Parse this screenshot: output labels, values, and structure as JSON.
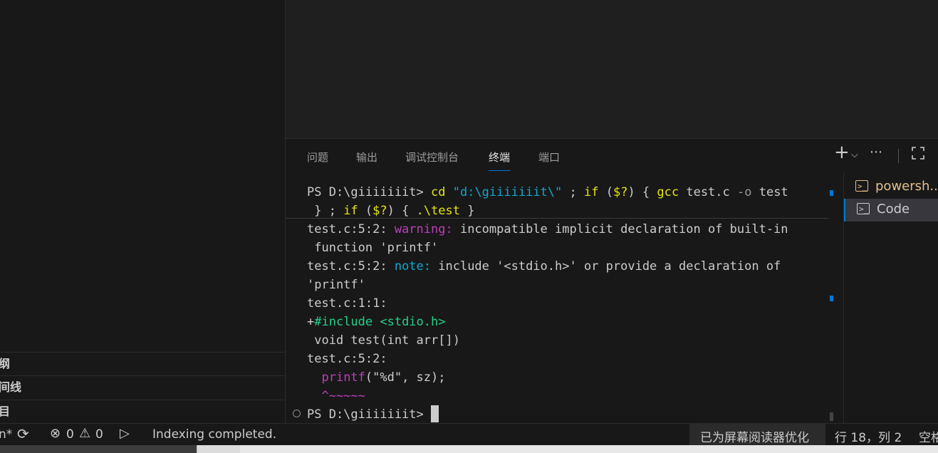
{
  "sidebar": {
    "sections": [
      "纲",
      "间线",
      "目"
    ]
  },
  "panel": {
    "tabs": [
      "问题",
      "输出",
      "调试控制台",
      "终端",
      "端口"
    ],
    "active_tab": "终端",
    "actions": {
      "add_icon": "plus-icon",
      "dropdown_icon": "chevron-down-icon",
      "more_icon": "ellipsis-icon",
      "maximize_icon": "maximize-icon"
    }
  },
  "terminal": {
    "prompt": "PS D:\\giiiiiiit> ",
    "cmd_cd": "cd",
    "cmd_path": "\"d:\\giiiiiiit\\\"",
    "cmd_semi1": " ; ",
    "cmd_if1": "if",
    "cmd_cond1_open": " (",
    "cmd_var1": "$?",
    "cmd_cond1_close": ") { ",
    "cmd_gcc": "gcc",
    "cmd_file": " test.c ",
    "cmd_flag": "-o",
    "cmd_out": " test",
    "line2_start": " } ; ",
    "cmd_if2": "if",
    "cmd_cond2_open": " (",
    "cmd_var2": "$?",
    "cmd_cond2_close": ") { ",
    "cmd_run": ".\\test",
    "cmd_end": " }",
    "w_loc": "test.c:5:2: ",
    "w_kw": "warning:",
    "w_msg": " incompatible implicit declaration of built-in",
    "w_msg2": " function 'printf'",
    "n_loc": "test.c:5:2: ",
    "n_kw": "note:",
    "n_msg": " include '<stdio.h>' or provide a declaration of",
    "n_msg2": "'printf'",
    "loc3": "test.c:1:1:",
    "plus": "+",
    "include": "#include <stdio.h>",
    "code1": " void test(int arr[])",
    "loc4": "test.c:5:2:",
    "code2_indent": "  ",
    "code2_fn": "printf",
    "code2_rest": "(\"%d\", sz);",
    "caret": "  ^~~~~~",
    "final_prompt": "PS D:\\giiiiiiit> "
  },
  "terminal_list": [
    {
      "label": "powersh...",
      "icon": "terminal-icon",
      "color": "#e2c08d"
    },
    {
      "label": "Code",
      "icon": "terminal-icon",
      "color": "#cccccc"
    }
  ],
  "status": {
    "branch_tail": "n*",
    "sync_icon": "sync-icon",
    "errors": "0",
    "warnings": "0",
    "error_icon": "error-icon",
    "warning_icon": "warning-icon",
    "debug_icon": "debug-icon",
    "message": "Indexing completed.",
    "screen_reader": "已为屏幕阅读器优化",
    "position": "行 18，列 2",
    "spaces": "空格"
  }
}
